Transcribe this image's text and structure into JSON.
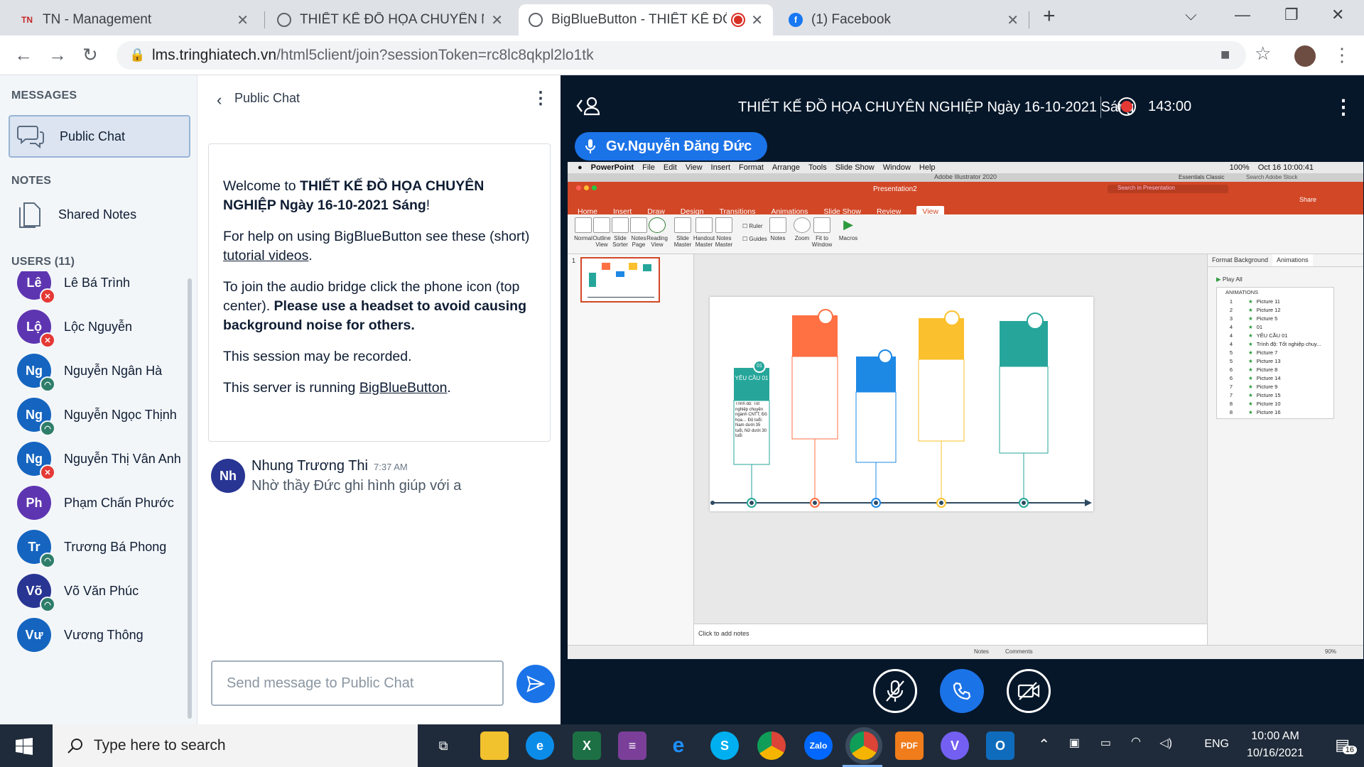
{
  "browser": {
    "tabs": [
      {
        "title": "TN - Management",
        "favicon": "TN"
      },
      {
        "title": "THIẾT KẾ ĐỒ HỌA CHUYÊN NGHIỆP",
        "favicon": "globe"
      },
      {
        "title": "BigBlueButton - THIẾT KẾ ĐỒ HỌA",
        "favicon": "globe",
        "active": true,
        "recording": true
      },
      {
        "title": "(1) Facebook",
        "favicon": "f"
      }
    ],
    "url_host": "lms.tringhiatech.vn",
    "url_path": "/html5client/join?sessionToken=rc8lc8qkpl2lo1tk"
  },
  "sidebar": {
    "messages_heading": "MESSAGES",
    "public_chat_label": "Public Chat",
    "notes_heading": "NOTES",
    "shared_notes_label": "Shared Notes",
    "users_heading": "USERS (11)",
    "users": [
      {
        "initials": "Lê",
        "name": "Lê Bá Trình",
        "color": "#5e35b1",
        "status": "muted"
      },
      {
        "initials": "Lộ",
        "name": "Lộc Nguyễn",
        "color": "#5e35b1",
        "status": "muted"
      },
      {
        "initials": "Ng",
        "name": "Nguyễn Ngân Hà",
        "color": "#1565c0",
        "status": "listen"
      },
      {
        "initials": "Ng",
        "name": "Nguyễn Ngọc Thịnh",
        "color": "#1565c0",
        "status": "listen"
      },
      {
        "initials": "Ng",
        "name": "Nguyễn Thị Vân Anh",
        "color": "#1565c0",
        "status": "muted"
      },
      {
        "initials": "Ph",
        "name": "Phạm Chấn Phước",
        "color": "#5e35b1",
        "status": "none"
      },
      {
        "initials": "Tr",
        "name": "Trương Bá Phong",
        "color": "#1565c0",
        "status": "listen"
      },
      {
        "initials": "Võ",
        "name": "Võ Văn Phúc",
        "color": "#283593",
        "status": "listen"
      },
      {
        "initials": "Vư",
        "name": "Vương Thông",
        "color": "#1565c0",
        "status": "none"
      }
    ]
  },
  "chat": {
    "header": "Public Chat",
    "welcome_1a": "Welcome to ",
    "welcome_1b": "THIẾT KẾ ĐỒ HỌA CHUYÊN NGHIỆP Ngày 16-10-2021 Sáng",
    "welcome_1c": "!",
    "welcome_2a": "For help on using BigBlueButton see these (short) ",
    "welcome_2link": "tutorial videos",
    "welcome_2c": ".",
    "welcome_3a": "To join the audio bridge click the phone icon (top center). ",
    "welcome_3b": "Please use a headset to avoid causing background noise for others.",
    "welcome_4": "This session may be recorded.",
    "welcome_5a": "This server is running ",
    "welcome_5link": "BigBlueButton",
    "welcome_5c": ".",
    "message": {
      "initials": "Nh",
      "author": "Nhung Trương Thi",
      "time": "7:37 AM",
      "text": "Nhờ thầy Đức ghi hình giúp với a"
    },
    "input_placeholder": "Send message to Public Chat"
  },
  "presentation": {
    "title": "THIẾT KẾ ĐỒ HỌA CHUYÊN NGHIỆP Ngày 16-10-2021 Sáng",
    "timer": "143:00",
    "presenter": "Gv.Nguyễn Đăng Đức"
  },
  "shared_screen": {
    "mac_menu": [
      "PowerPoint",
      "File",
      "Edit",
      "View",
      "Insert",
      "Format",
      "Arrange",
      "Tools",
      "Slide Show",
      "Window",
      "Help"
    ],
    "mac_clock": "Oct 16  10:00:41",
    "mac_battery": "100%",
    "window_title": "Adobe Illustrator 2020",
    "doc_title": "Presentation2",
    "workspace": "Essentials Classic",
    "search_stock": "Search Adobe Stock",
    "search_presentation": "Search in Presentation",
    "share": "Share",
    "ribbon_tabs": [
      "Home",
      "Insert",
      "Draw",
      "Design",
      "Transitions",
      "Animations",
      "Slide Show",
      "Review",
      "View"
    ],
    "ribbon_buttons": [
      "Normal",
      "Outline View",
      "Slide Sorter",
      "Notes Page",
      "Reading View",
      "Slide Master",
      "Handout Master",
      "Notes Master",
      "Ruler",
      "Guides",
      "Notes",
      "Zoom",
      "Fit to Window",
      "Macros"
    ],
    "slide_number": "1",
    "notes_placeholder": "Click to add notes",
    "pane_tabs": [
      "Format Background",
      "Animations"
    ],
    "play_all": "Play All",
    "animations_heading": "ANIMATIONS",
    "animations": [
      {
        "n": "1",
        "name": "Picture 11"
      },
      {
        "n": "2",
        "name": "Picture 12"
      },
      {
        "n": "3",
        "name": "Picture 5"
      },
      {
        "n": "4",
        "name": "01"
      },
      {
        "n": "4",
        "name": "YÊU CẦU 01"
      },
      {
        "n": "4",
        "name": "Trình độ: Tốt nghiệp chuy..."
      },
      {
        "n": "5",
        "name": "Picture 7"
      },
      {
        "n": "5",
        "name": "Picture 13"
      },
      {
        "n": "6",
        "name": "Picture 8"
      },
      {
        "n": "6",
        "name": "Picture 14"
      },
      {
        "n": "7",
        "name": "Picture 9"
      },
      {
        "n": "7",
        "name": "Picture 15"
      },
      {
        "n": "8",
        "name": "Picture 10"
      },
      {
        "n": "8",
        "name": "Picture 16"
      }
    ],
    "slide_card_title": "YÊU CẦU 01",
    "slide_card_circle": "01",
    "slide_card_text": "Trình độ: Tốt nghiệp chuyên ngành CNTT, Đồ họa… Độ tuổi: Nam dưới 35 tuổi, Nữ dưới 30 tuổi",
    "status_notes": "Notes",
    "status_comments": "Comments",
    "zoom": "90%"
  },
  "taskbar": {
    "search_placeholder": "Type here to search",
    "apps": [
      "Task View",
      "File Explorer",
      "Edge",
      "Excel",
      "WinRAR",
      "Internet Explorer",
      "Skype",
      "Chrome",
      "Zalo",
      "Chrome",
      "PDF",
      "Viber",
      "Outlook"
    ],
    "language": "ENG",
    "time": "10:00 AM",
    "date": "10/16/2021",
    "notification_count": "16"
  }
}
